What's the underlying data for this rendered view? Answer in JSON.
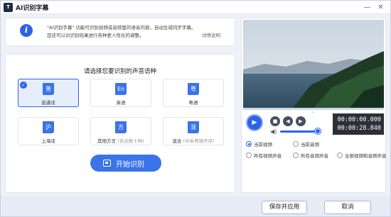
{
  "window": {
    "title": "AI识别字幕",
    "logo_text": "T",
    "minimize_icon": "minimize-icon",
    "close_icon": "close-icon"
  },
  "info": {
    "icon": "info-icon",
    "icon_glyph": "i",
    "text": "\"AI识别字幕\" 功能可识别视频或音频里的语音内容，自动生成同步字幕。您还可以对识别结果进行各种更人性化的调整。",
    "link": "详情说明"
  },
  "language": {
    "prompt": "请选择您要识别的声音语种",
    "selected_check": "✓",
    "options": [
      {
        "glyph": "普",
        "name": "普通话",
        "sub": "",
        "selected": true
      },
      {
        "glyph": "En",
        "name": "英语",
        "sub": "",
        "selected": false
      },
      {
        "glyph": "粤",
        "name": "粤语",
        "sub": "",
        "selected": false
      },
      {
        "glyph": "沪",
        "name": "上海话",
        "sub": "",
        "selected": false
      },
      {
        "glyph": "方",
        "name": "其他方言",
        "sub": "(多达数十种)",
        "selected": false
      },
      {
        "glyph": "混",
        "name": "混合",
        "sub": "(中英粤随开存)",
        "selected": false
      }
    ],
    "start_button": "开始识别"
  },
  "player": {
    "current_time": "00:00:00.000",
    "total_time": "00:00:28.840",
    "play_glyph": "▶",
    "stop_glyph": "■",
    "prev_glyph": "◀",
    "next_glyph": "▶",
    "volume_glyph": "◀)",
    "seek_glyph": "⌄",
    "volume_level": 0.95
  },
  "source": {
    "options": [
      {
        "label": "当前视频",
        "checked": true
      },
      {
        "label": "当前音频",
        "checked": false
      },
      {
        "label": "所有视频声音",
        "checked": false
      },
      {
        "label": "所有音频声音",
        "checked": false
      },
      {
        "label": "全部视频和音频声音",
        "checked": false
      }
    ]
  },
  "footer": {
    "save_label": "保存并应用",
    "cancel_label": "取消"
  },
  "colors": {
    "accent": "#2d63e6",
    "background": "#eef1f7",
    "timecode_bg": "#2b2f36"
  }
}
